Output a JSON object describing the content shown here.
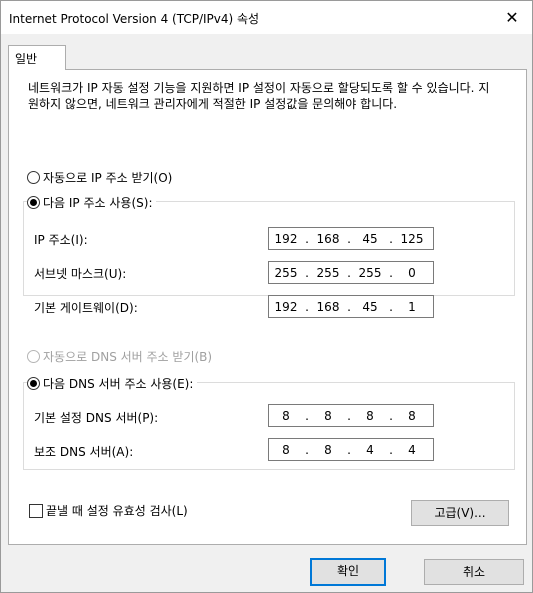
{
  "window": {
    "title": "Internet Protocol Version 4 (TCP/IPv4) 속성",
    "close_glyph": "✕"
  },
  "tabs": [
    {
      "label": "일반"
    }
  ],
  "description": "네트워크가 IP 자동 설정 기능을 지원하면 IP 설정이 자동으로 할당되도록 할 수 있습니다. 지원하지 않으면, 네트워크 관리자에게 적절한 IP 설정값을 문의해야 합니다.",
  "ip": {
    "auto_label": "자동으로 IP 주소 받기(O)",
    "manual_label": "다음 IP 주소 사용(S):",
    "selected": "manual",
    "fields": [
      {
        "label": "IP 주소(I):",
        "value": [
          "192",
          "168",
          "45",
          "125"
        ]
      },
      {
        "label": "서브넷 마스크(U):",
        "value": [
          "255",
          "255",
          "255",
          "0"
        ]
      },
      {
        "label": "기본 게이트웨이(D):",
        "value": [
          "192",
          "168",
          "45",
          "1"
        ]
      }
    ]
  },
  "dns": {
    "auto_label": "자동으로 DNS 서버 주소 받기(B)",
    "manual_label": "다음 DNS 서버 주소 사용(E):",
    "selected": "manual",
    "fields": [
      {
        "label": "기본 설정 DNS 서버(P):",
        "value": [
          "8",
          "8",
          "8",
          "8"
        ]
      },
      {
        "label": "보조 DNS 서버(A):",
        "value": [
          "8",
          "8",
          "4",
          "4"
        ]
      }
    ]
  },
  "validate_checkbox": {
    "label": "끝낼 때 설정 유효성 검사(L)",
    "checked": false
  },
  "buttons": {
    "advanced": "고급(V)...",
    "ok": "확인",
    "cancel": "취소"
  },
  "colors": {
    "accent": "#0078d7",
    "disabled_text": "#a0a0a0"
  }
}
